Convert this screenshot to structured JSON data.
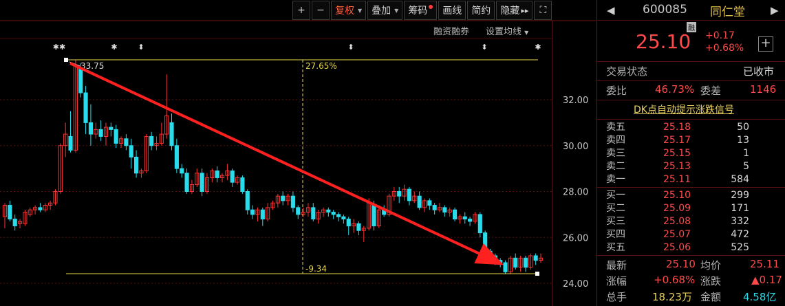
{
  "toolbar": {
    "zoom_in": "+",
    "zoom_out": "−",
    "fuquan": "复权",
    "diejia": "叠加",
    "chouma": "筹码",
    "huaxian": "画线",
    "jianyue": "简约",
    "yincang": "隐藏",
    "more": "▸▸",
    "fullscreen": "⛶"
  },
  "sub_toolbar": {
    "margin": "融资融券",
    "ma_settings": "设置均线"
  },
  "chart_data": {
    "type": "candlestick",
    "y_ticks": [
      "32.00",
      "30.00",
      "28.00",
      "26.00",
      "24.00"
    ],
    "ylim": [
      23.6,
      34.0
    ],
    "high_label": "33.75",
    "pct_up_label": "27.65%",
    "pct_down_label": "-9.34",
    "event_markers": [
      "✱✱",
      "✱",
      "⬍",
      "⬍",
      "⬍",
      "✱"
    ],
    "candles": [
      [
        26.9,
        27.4,
        26.4,
        27.5
      ],
      [
        27.4,
        26.8,
        26.7,
        27.6
      ],
      [
        26.8,
        26.5,
        26.3,
        27.0
      ],
      [
        26.6,
        26.7,
        26.4,
        26.8
      ],
      [
        26.6,
        27.1,
        26.5,
        27.2
      ],
      [
        27.0,
        27.2,
        26.9,
        27.3
      ],
      [
        27.2,
        27.3,
        27.0,
        27.4
      ],
      [
        27.3,
        27.2,
        27.1,
        27.5
      ],
      [
        27.2,
        27.4,
        27.1,
        27.5
      ],
      [
        27.4,
        27.5,
        27.2,
        27.6
      ],
      [
        27.5,
        28.0,
        27.4,
        28.1
      ],
      [
        28.0,
        30.0,
        27.9,
        30.1
      ],
      [
        30.0,
        30.5,
        29.5,
        31.0
      ],
      [
        30.4,
        29.8,
        29.7,
        31.5
      ],
      [
        29.8,
        33.5,
        29.7,
        33.75
      ],
      [
        33.4,
        32.3,
        32.1,
        33.6
      ],
      [
        32.3,
        31.0,
        30.5,
        32.6
      ],
      [
        31.0,
        30.5,
        30.0,
        31.8
      ],
      [
        30.5,
        30.7,
        30.3,
        31.0
      ],
      [
        30.7,
        30.4,
        30.2,
        31.1
      ],
      [
        30.4,
        30.8,
        30.0,
        31.0
      ],
      [
        30.8,
        30.7,
        30.4,
        31.0
      ],
      [
        30.7,
        30.1,
        29.9,
        30.9
      ],
      [
        30.1,
        30.3,
        29.9,
        30.4
      ],
      [
        30.3,
        30.0,
        29.8,
        30.5
      ],
      [
        30.0,
        29.5,
        29.0,
        30.3
      ],
      [
        29.5,
        28.8,
        28.6,
        29.8
      ],
      [
        28.8,
        28.9,
        28.6,
        29.0
      ],
      [
        28.9,
        30.4,
        28.8,
        30.5
      ],
      [
        30.4,
        30.0,
        29.8,
        30.6
      ],
      [
        30.0,
        30.1,
        29.8,
        30.4
      ],
      [
        30.1,
        30.5,
        30.0,
        31.0
      ],
      [
        30.5,
        31.3,
        30.3,
        33.1
      ],
      [
        31.0,
        30.0,
        29.8,
        31.4
      ],
      [
        30.0,
        29.0,
        28.8,
        30.3
      ],
      [
        29.0,
        28.8,
        28.6,
        29.2
      ],
      [
        28.8,
        28.0,
        27.9,
        29.0
      ],
      [
        28.0,
        28.3,
        27.9,
        28.5
      ],
      [
        28.3,
        28.8,
        28.2,
        29.0
      ],
      [
        28.8,
        28.0,
        27.8,
        29.0
      ],
      [
        28.0,
        28.6,
        27.9,
        28.8
      ],
      [
        28.6,
        28.9,
        28.4,
        29.0
      ],
      [
        28.9,
        28.6,
        28.4,
        29.1
      ],
      [
        28.6,
        28.7,
        28.4,
        28.8
      ],
      [
        28.7,
        28.9,
        28.5,
        29.2
      ],
      [
        28.9,
        28.4,
        28.2,
        29.0
      ],
      [
        28.4,
        28.6,
        28.3,
        28.7
      ],
      [
        28.6,
        28.0,
        27.9,
        28.7
      ],
      [
        28.0,
        27.2,
        27.0,
        28.1
      ],
      [
        27.2,
        27.0,
        26.8,
        27.4
      ],
      [
        27.0,
        27.2,
        26.7,
        27.3
      ],
      [
        27.2,
        26.8,
        26.5,
        27.3
      ],
      [
        26.8,
        27.3,
        26.7,
        27.5
      ],
      [
        27.3,
        27.5,
        27.2,
        27.6
      ],
      [
        27.5,
        27.8,
        27.3,
        27.9
      ],
      [
        27.8,
        27.6,
        27.4,
        28.0
      ],
      [
        27.6,
        27.8,
        27.4,
        27.9
      ],
      [
        27.8,
        27.3,
        27.1,
        28.0
      ],
      [
        27.3,
        27.0,
        26.8,
        27.4
      ],
      [
        27.0,
        27.1,
        26.9,
        27.3
      ],
      [
        27.1,
        27.3,
        26.9,
        27.5
      ],
      [
        27.3,
        26.8,
        26.7,
        27.5
      ],
      [
        26.8,
        27.1,
        26.6,
        27.2
      ],
      [
        27.1,
        27.2,
        26.9,
        27.3
      ],
      [
        27.2,
        27.1,
        26.9,
        27.3
      ],
      [
        27.1,
        27.0,
        26.8,
        27.2
      ],
      [
        27.0,
        26.9,
        26.7,
        27.1
      ],
      [
        26.9,
        26.8,
        26.6,
        27.0
      ],
      [
        26.8,
        26.5,
        26.1,
        26.9
      ],
      [
        26.5,
        26.6,
        26.2,
        26.8
      ],
      [
        26.6,
        26.3,
        26.1,
        26.7
      ],
      [
        26.3,
        26.4,
        25.8,
        26.5
      ],
      [
        26.4,
        27.5,
        26.3,
        27.7
      ],
      [
        27.4,
        26.5,
        26.3,
        27.6
      ],
      [
        26.5,
        27.2,
        26.4,
        27.3
      ],
      [
        27.2,
        27.0,
        26.9,
        27.4
      ],
      [
        27.0,
        27.8,
        26.9,
        27.9
      ],
      [
        27.8,
        28.0,
        27.6,
        28.2
      ],
      [
        28.0,
        27.8,
        27.5,
        28.2
      ],
      [
        27.8,
        28.1,
        27.6,
        28.3
      ],
      [
        28.1,
        27.6,
        27.4,
        28.2
      ],
      [
        27.6,
        27.8,
        27.5,
        28.0
      ],
      [
        27.8,
        27.3,
        27.2,
        28.0
      ],
      [
        27.3,
        27.6,
        27.1,
        27.7
      ],
      [
        27.6,
        27.4,
        27.2,
        27.7
      ],
      [
        27.4,
        27.2,
        27.0,
        27.5
      ],
      [
        27.2,
        27.3,
        27.1,
        27.5
      ],
      [
        27.3,
        27.1,
        26.9,
        27.4
      ],
      [
        27.1,
        27.2,
        26.9,
        27.3
      ],
      [
        27.2,
        26.8,
        26.7,
        27.3
      ],
      [
        26.8,
        26.9,
        26.6,
        27.0
      ],
      [
        26.9,
        26.8,
        26.6,
        27.1
      ],
      [
        26.8,
        26.7,
        26.5,
        26.9
      ],
      [
        26.7,
        27.0,
        26.6,
        27.1
      ],
      [
        27.0,
        26.2,
        26.0,
        27.1
      ],
      [
        26.2,
        25.4,
        25.2,
        26.3
      ],
      [
        25.4,
        25.2,
        24.9,
        25.5
      ],
      [
        25.2,
        25.0,
        24.8,
        25.3
      ],
      [
        25.0,
        24.9,
        24.7,
        25.1
      ],
      [
        24.9,
        24.5,
        24.4,
        25.0
      ],
      [
        24.5,
        25.1,
        24.4,
        25.2
      ],
      [
        25.1,
        24.7,
        24.6,
        25.3
      ],
      [
        24.7,
        25.1,
        24.5,
        25.2
      ],
      [
        25.1,
        24.7,
        24.5,
        25.2
      ],
      [
        24.7,
        25.2,
        24.6,
        25.3
      ],
      [
        25.2,
        25.0,
        24.8,
        25.3
      ],
      [
        25.0,
        25.1,
        24.9,
        25.3
      ]
    ]
  },
  "quote": {
    "code": "600085",
    "name": "同仁堂",
    "rong": "融",
    "price": "25.10",
    "change": "+0.17",
    "change_pct": "+0.68%",
    "plus": "+",
    "status_label": "交易状态",
    "status_value": "已收市",
    "weibi_label": "委比",
    "weibi_value": "46.73%",
    "weicha_label": "委差",
    "weicha_value": "1146",
    "dk_signal": "DK点自动提示涨跌信号"
  },
  "sells": [
    {
      "label": "卖五",
      "price": "25.18",
      "vol": "50"
    },
    {
      "label": "卖四",
      "price": "25.17",
      "vol": "13"
    },
    {
      "label": "卖三",
      "price": "25.15",
      "vol": "1"
    },
    {
      "label": "卖二",
      "price": "25.13",
      "vol": "5"
    },
    {
      "label": "卖一",
      "price": "25.11",
      "vol": "584"
    }
  ],
  "buys": [
    {
      "label": "买一",
      "price": "25.10",
      "vol": "299"
    },
    {
      "label": "买二",
      "price": "25.09",
      "vol": "171"
    },
    {
      "label": "买三",
      "price": "25.08",
      "vol": "332"
    },
    {
      "label": "买四",
      "price": "25.07",
      "vol": "472"
    },
    {
      "label": "买五",
      "price": "25.06",
      "vol": "525"
    }
  ],
  "stats": {
    "latest_label": "最新",
    "latest_value": "25.10",
    "avg_label": "均价",
    "avg_value": "25.11",
    "pct_label": "涨幅",
    "pct_value": "+0.68%",
    "chg_label": "涨跌",
    "chg_value": "▲0.17",
    "vol_label": "总手",
    "vol_value": "18.23万",
    "amt_label": "金额",
    "amt_value": "4.58亿"
  },
  "colors": {
    "up": "#ff3232",
    "down": "#28dcec",
    "level": "#e8d84a",
    "arrow": "#ff2020"
  }
}
